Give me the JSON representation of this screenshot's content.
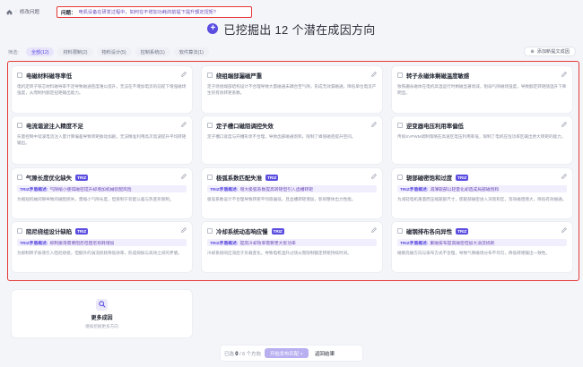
{
  "topbar": {
    "back_label": "修改问题",
    "question_label": "问题：",
    "question_text": "电机设备在研发过程中，如何在不增加功耗的前提下提升额定扭矩?"
  },
  "headline": {
    "title": "已挖掘出 12 个潜在成因方向"
  },
  "filters": {
    "label": "筛选:",
    "chips": [
      "全部(12)",
      "材料限制(2)",
      "物料设计(5)",
      "控制系统(1)",
      "软件算法(1)"
    ],
    "add_label": "添加新提文成因"
  },
  "cards": [
    {
      "title": "电磁材料磁导率低",
      "triz_label": "",
      "triz_text": "",
      "desc": "电机定转子铁芯材料磁导率不足导致磁通密度难以提升，无法在不增加电流的前提下增强磁场强度，从而制约额定扭矩输出能力。"
    },
    {
      "title": "绕组端部漏磁严重",
      "triz_label": "",
      "triz_text": "",
      "desc": "定子绕组端部结构设计不合理导致大量磁通未耦合至气隙，形成无效漏磁通，降低单位电流产生的有效转矩系数。"
    },
    {
      "title": "转子永磁体剩磁温度敏感",
      "triz_label": "",
      "triz_text": "",
      "desc": "钕铁硼永磁体在电机高温运行时剩磁显著衰减，削弱气隙磁场强度，导致额定转矩随温升下降明显。"
    },
    {
      "title": "电流谐波注入精度不足",
      "triz_label": "",
      "triz_text": "",
      "desc": "矢量控制中谐波电流注入量计算偏差导致转矩脉动加剧，无法精准利用高次谐波提升平均转矩输出。"
    },
    {
      "title": "定子槽口磁阻调控失效",
      "triz_label": "",
      "triz_text": "",
      "desc": "定子槽口宽度与开槽形状不合理，导致齿部磁通饱和，限制了峰值磁密提升空间。"
    },
    {
      "title": "逆变器电压利用率偏低",
      "triz_label": "",
      "triz_text": "",
      "desc": "传统SVPWM调制策略在高速区电压利用率低，限制了电机在恒功率区输出更大转矩的能力。"
    },
    {
      "title": "气隙长度优化缺失",
      "triz_label": "TRIZ矛盾概述:",
      "triz_text": "气隙缩小使得磁密提升却增加机械装配风险",
      "desc": "为缩短机械间隙导致的磁阻损失，需缩小气隙长度，但受制于装配公差与热变形限制。"
    },
    {
      "title": "极弧系数匹配失准",
      "triz_label": "TRIZ矛盾概述:",
      "triz_text": "增大极弧系数提高转矩但引入齿槽转矩",
      "desc": "极弧系数设计不合理导致转矩平均值偏低，且齿槽转矩增加，影响整体出力性能。"
    },
    {
      "title": "轭部磁密饱和过度",
      "triz_label": "TRIZ矛盾概述:",
      "triz_text": "减薄轭部以轻量化却造成局部磁饱和",
      "desc": "为减轻电机重量而压缩轭部尺寸，使轭部磁密进入深饱和区，等效磁阻增大，降低有效磁通。"
    },
    {
      "title": "阻尼绕组设计缺陷",
      "triz_label": "TRIZ矛盾概述:",
      "triz_text": "抑制振荡需要阻尼但阻尼损耗增加",
      "desc": "为抑制转子振荡引入阻尼绕组，但额外的涡流损耗降低效率，形成抑振与高效之间的矛盾。"
    },
    {
      "title": "冷却系统动态响应慢",
      "triz_label": "TRIZ矛盾概述:",
      "triz_text": "提高冷却效率需要更大泵功率",
      "desc": "冷却系统响应滞后于负载变化，导致电机温升过快从而限制额定转矩持续时间。"
    },
    {
      "title": "磁钢排布各向异性",
      "triz_label": "TRIZ矛盾概述:",
      "triz_text": "聚磁排布提高磁密但加大涡流损耗",
      "desc": "磁钢充磁方向与排布方式不合理，导致气隙磁场分布不均匀，降低转矩输出一致性。"
    }
  ],
  "more_card": {
    "title": "更多成因",
    "subtitle": "继续挖掘更多方向"
  },
  "bottom": {
    "selected_prefix": "已选",
    "selected_count": "0",
    "selected_suffix": "/ 6 个方向",
    "start_label": "开始发布匹配 >",
    "return_label": "返回结果"
  }
}
